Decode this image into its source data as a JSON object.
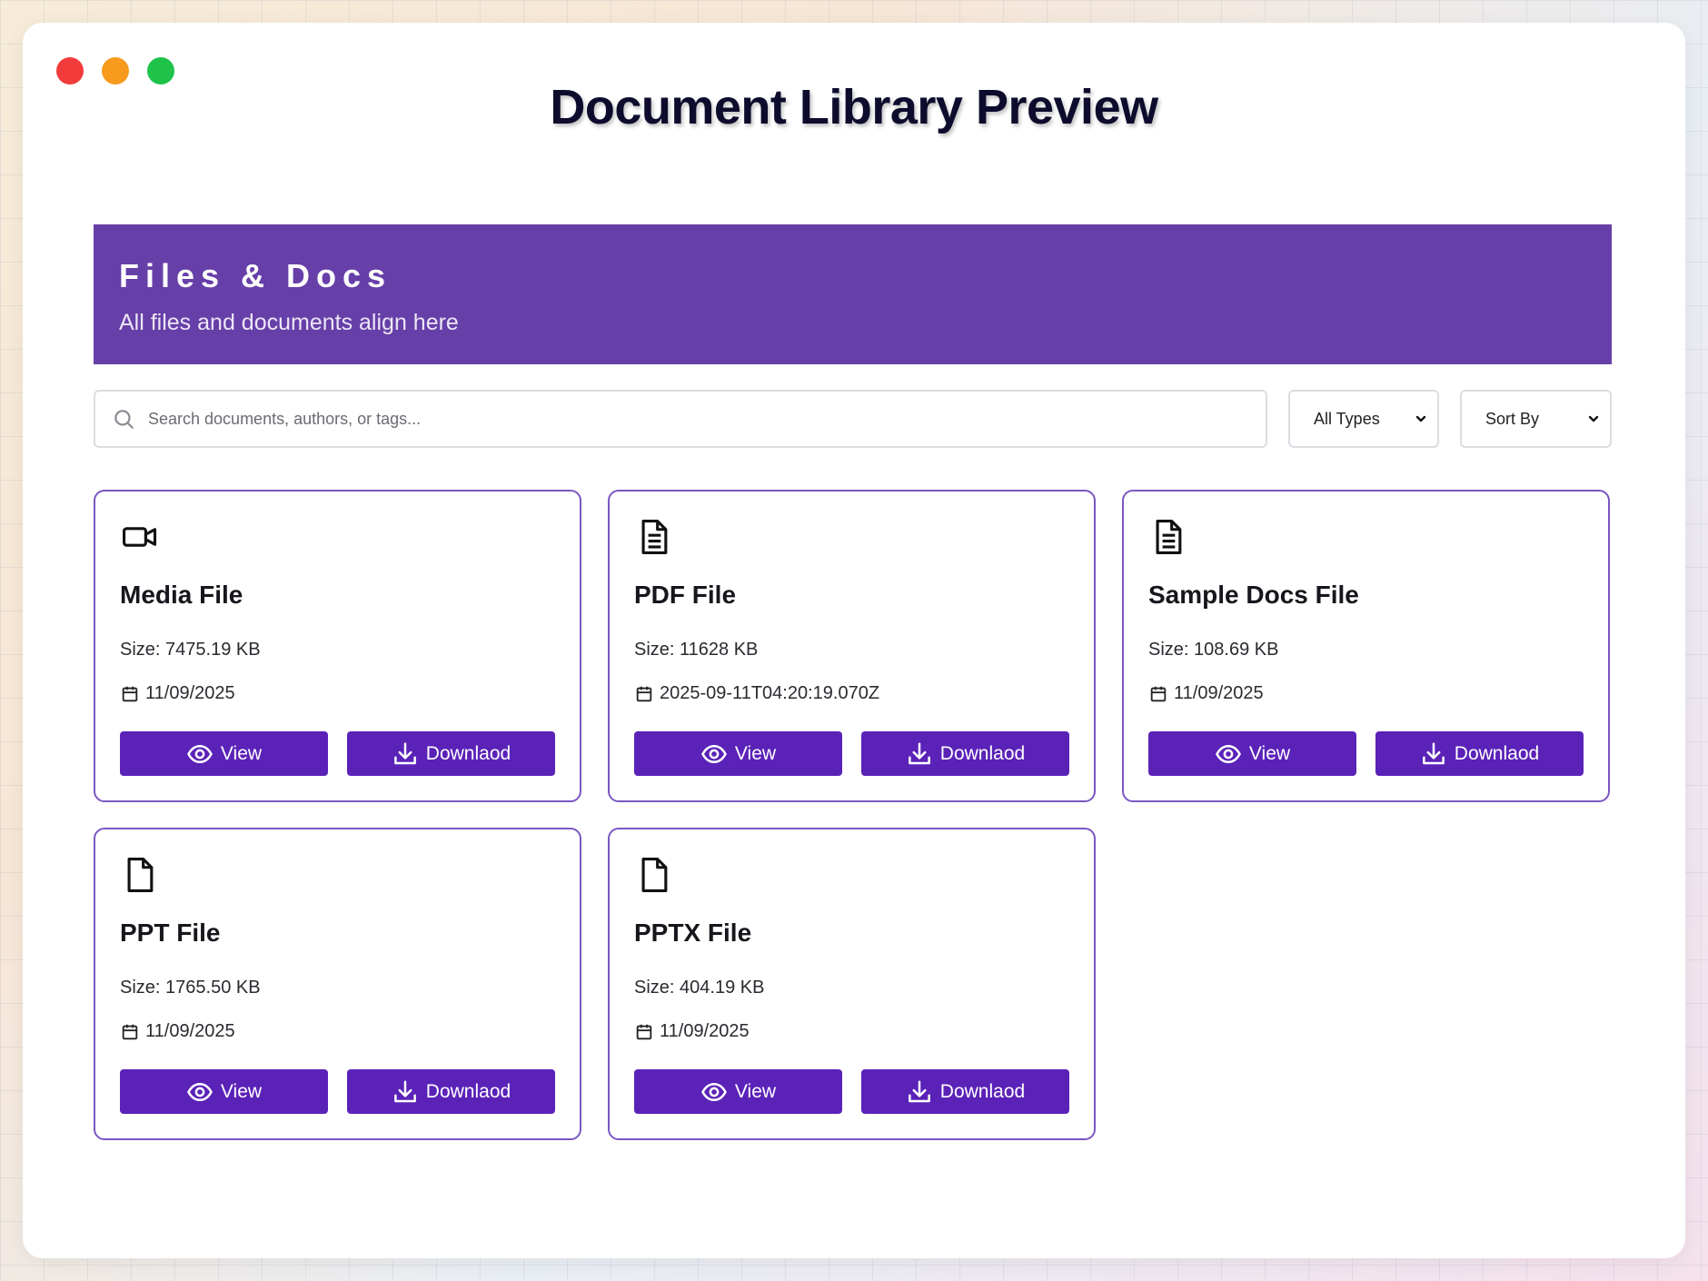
{
  "window": {
    "title": "Document Library Preview",
    "controls": [
      "close",
      "minimize",
      "maximize"
    ]
  },
  "banner": {
    "title": "Files & Docs",
    "subtitle": "All files and documents align here",
    "color": "#673fa8"
  },
  "toolbar": {
    "search_placeholder": "Search documents, authors, or tags...",
    "type_filter": "All Types",
    "sort": "Sort By"
  },
  "cards": [
    {
      "icon": "video-icon",
      "name": "Media File",
      "size": "Size: 7475.19 KB",
      "date": "11/09/2025",
      "view_label": "View",
      "download_label": "Downlaod"
    },
    {
      "icon": "document-text-icon",
      "name": "PDF File",
      "size": "Size: 11628 KB",
      "date": "2025-09-11T04:20:19.070Z",
      "view_label": "View",
      "download_label": "Downlaod"
    },
    {
      "icon": "document-text-icon",
      "name": "Sample Docs File",
      "size": "Size: 108.69 KB",
      "date": "11/09/2025",
      "view_label": "View",
      "download_label": "Downlaod"
    },
    {
      "icon": "file-icon",
      "name": "PPT File",
      "size": "Size: 1765.50 KB",
      "date": "11/09/2025",
      "view_label": "View",
      "download_label": "Downlaod"
    },
    {
      "icon": "file-icon",
      "name": "PPTX File",
      "size": "Size: 404.19 KB",
      "date": "11/09/2025",
      "view_label": "View",
      "download_label": "Downlaod"
    }
  ],
  "colors": {
    "accent": "#5b22b8",
    "card_border": "#7b56c3"
  }
}
